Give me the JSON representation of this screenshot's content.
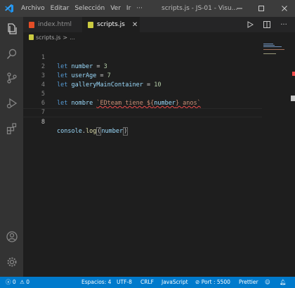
{
  "window": {
    "title": "scripts.js - JS-01 - Visu...",
    "menu": [
      "Archivo",
      "Editar",
      "Selección",
      "Ver",
      "Ir",
      "···"
    ]
  },
  "tabs": [
    {
      "label": "index.html",
      "icon": "html-file-icon",
      "color": "#e44d26",
      "active": false
    },
    {
      "label": "scripts.js",
      "icon": "js-file-icon",
      "color": "#cbcb41",
      "active": true
    }
  ],
  "breadcrumb": {
    "file": "scripts.js",
    "separator": ">",
    "more": "..."
  },
  "code": {
    "lines": [
      {
        "n": "1",
        "kw": "let",
        "name": "number",
        "op": " = ",
        "val": "3"
      },
      {
        "n": "2",
        "kw": "let",
        "name": "userAge",
        "op": " = ",
        "val": "7"
      },
      {
        "n": "3",
        "kw": "let",
        "name": "galleryMainContainer",
        "op": " = ",
        "val": "10"
      },
      {
        "n": "4"
      },
      {
        "n": "5",
        "kw": "let",
        "name": "nombre",
        "tpl_open": "`EDteam tiene ${",
        "tpl_var": "number",
        "tpl_close": "} anos`"
      },
      {
        "n": "6"
      },
      {
        "n": "7"
      },
      {
        "n": "8",
        "obj": "console",
        "dot": ".",
        "fn": "log",
        "open": "(",
        "arg": "number",
        "close": ")"
      }
    ]
  },
  "statusbar": {
    "errors": "0",
    "warnings": "0",
    "spaces": "Espacios: 4",
    "encoding": "UTF-8",
    "eol": "CRLF",
    "language": "JavaScript",
    "port": "Port : 5500",
    "formatter": "Prettier"
  },
  "colors": {
    "accent": "#007acc",
    "keyword": "#569cd6",
    "variable": "#9cdcfe",
    "number": "#b5cea8",
    "string": "#ce9178",
    "function": "#dcdcaa",
    "error": "#f14c4c"
  }
}
